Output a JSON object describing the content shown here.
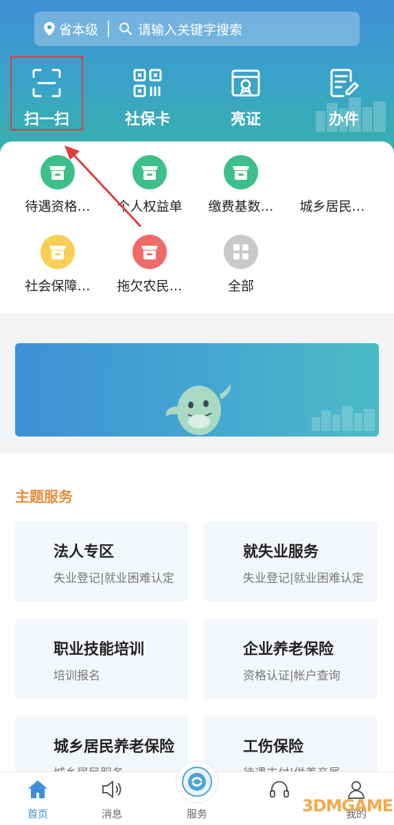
{
  "search": {
    "location": "省本级",
    "placeholder": "请输入关键字搜索"
  },
  "quick_actions": [
    {
      "label": "扫一扫",
      "icon": "scan-icon"
    },
    {
      "label": "社保卡",
      "icon": "qr-code-icon"
    },
    {
      "label": "亮证",
      "icon": "certificate-icon"
    },
    {
      "label": "办件",
      "icon": "document-edit-icon"
    }
  ],
  "services": [
    {
      "label": "待遇资格…",
      "icon": "box-icon",
      "color": "#3dbf8c"
    },
    {
      "label": "个人权益单",
      "icon": "box-icon",
      "color": "#3dbf8c"
    },
    {
      "label": "缴费基数…",
      "icon": "box-icon",
      "color": "#3dbf8c"
    },
    {
      "label": "城乡居民…",
      "icon": "",
      "color": ""
    },
    {
      "label": "社会保障…",
      "icon": "box-icon",
      "color": "#f7cf55"
    },
    {
      "label": "拖欠农民…",
      "icon": "box-icon",
      "color": "#f06a6a"
    },
    {
      "label": "全部",
      "icon": "grid-icon",
      "color": "#c9c9c9"
    }
  ],
  "themes": {
    "title": "主题服务",
    "items": [
      {
        "title": "法人专区",
        "subtitle": "失业登记|就业困难认定"
      },
      {
        "title": "就失业服务",
        "subtitle": "失业登记|就业困难认定"
      },
      {
        "title": "职业技能培训",
        "subtitle": "培训报名"
      },
      {
        "title": "企业养老保险",
        "subtitle": "资格认证|帐户查询"
      },
      {
        "title": "城乡居民养老保险",
        "subtitle": "城乡居民服务"
      },
      {
        "title": "工伤保险",
        "subtitle": "待遇支付|供养亲属"
      }
    ]
  },
  "tabs": [
    {
      "label": "首页",
      "icon": "home-icon"
    },
    {
      "label": "消息",
      "icon": "speaker-icon"
    },
    {
      "label": "服务",
      "icon": "service-logo-icon"
    },
    {
      "label": "",
      "icon": "headset-icon"
    },
    {
      "label": "我的",
      "icon": "user-icon"
    }
  ],
  "watermark": "3DMGAME",
  "colors": {
    "header": "#3f8fd6",
    "accent": "#e78b3b",
    "highlight": "#e23b3b",
    "active_tab": "#3f8fd6"
  }
}
